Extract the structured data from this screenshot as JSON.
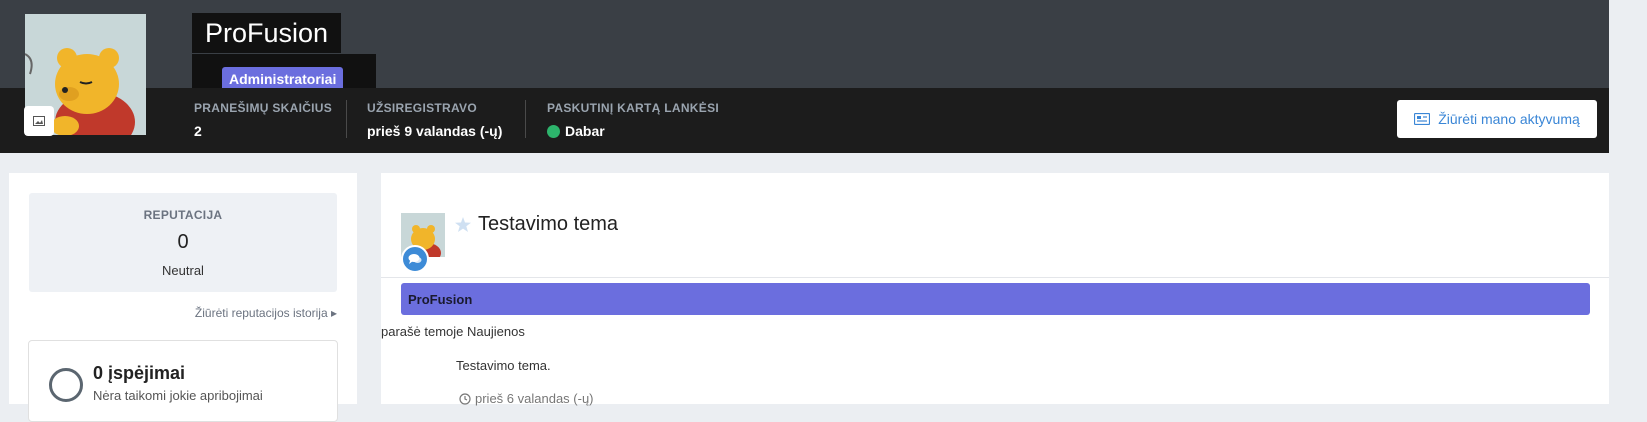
{
  "profile": {
    "name": "ProFusion",
    "group": "Administratoriai",
    "avatar_alt": "Winnie the Pooh avatar"
  },
  "stats": [
    {
      "label": "PRANEŠIMŲ SKAIČIUS",
      "value": "2"
    },
    {
      "label": "UŽSIREGISTRAVO",
      "value": "prieš 9 valandas (-ų)"
    },
    {
      "label": "PASKUTINĮ KARTĄ LANKĖSI",
      "value": "Dabar"
    }
  ],
  "activity_button": "Žiūrėti mano aktyvumą",
  "sidebar": {
    "reputation_label": "REPUTACIJA",
    "reputation_value": "0",
    "reputation_desc": "Neutral",
    "reputation_link": "Žiūrėti reputacijos istorija",
    "warnings_title": "0 įspėjimai",
    "warnings_desc": "Nėra taikomi jokie apribojimai"
  },
  "post": {
    "title": "Testavimo tema",
    "author": "ProFusion",
    "wrote_prefix": "parašė temoje",
    "forum": "Naujienos",
    "body": "Testavimo tema.",
    "time": "prieš 6 valandas (-ų)"
  },
  "colors": {
    "header": "#3a3f45",
    "stats_bar": "#1c1c1c",
    "group_badge": "#6b6ede",
    "online": "#2db46c",
    "link": "#3a86d6"
  },
  "icons": [
    "image-icon",
    "activity-icon",
    "chat-icon",
    "star-icon",
    "clock-icon",
    "caret-right-icon"
  ]
}
